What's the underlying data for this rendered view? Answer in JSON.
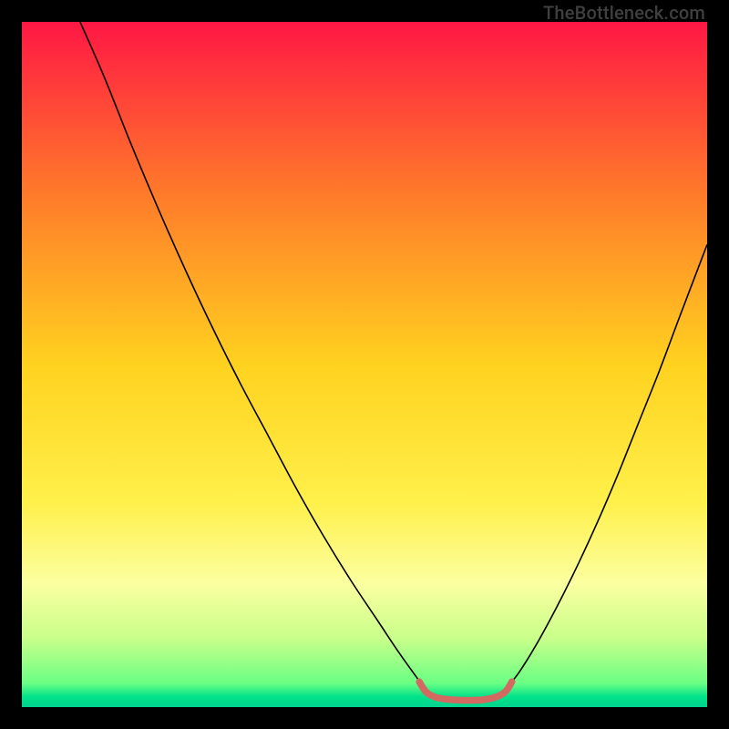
{
  "watermark": "TheBottleneck.com",
  "chart_data": {
    "type": "line",
    "title": "",
    "xlabel": "",
    "ylabel": "",
    "xlim": [
      0,
      100
    ],
    "ylim": [
      0,
      100
    ],
    "background_gradient": {
      "stops": [
        {
          "offset": 0.0,
          "color": "#ff1744"
        },
        {
          "offset": 0.25,
          "color": "#ff7a2a"
        },
        {
          "offset": 0.5,
          "color": "#ffd21f"
        },
        {
          "offset": 0.7,
          "color": "#fff04a"
        },
        {
          "offset": 0.82,
          "color": "#fbffa0"
        },
        {
          "offset": 0.9,
          "color": "#c8ff8a"
        },
        {
          "offset": 0.965,
          "color": "#6bff84"
        },
        {
          "offset": 0.985,
          "color": "#00e28a"
        },
        {
          "offset": 1.0,
          "color": "#00d38f"
        }
      ]
    },
    "series": [
      {
        "name": "left-curve",
        "stroke": "#000000",
        "width": 1.6,
        "points": [
          {
            "x": 8.5,
            "y": 100.0
          },
          {
            "x": 12.0,
            "y": 92.0
          },
          {
            "x": 16.0,
            "y": 82.0
          },
          {
            "x": 20.0,
            "y": 72.5
          },
          {
            "x": 24.0,
            "y": 63.5
          },
          {
            "x": 28.0,
            "y": 55.0
          },
          {
            "x": 32.0,
            "y": 47.0
          },
          {
            "x": 36.0,
            "y": 39.5
          },
          {
            "x": 40.0,
            "y": 32.0
          },
          {
            "x": 44.0,
            "y": 25.0
          },
          {
            "x": 48.0,
            "y": 18.5
          },
          {
            "x": 52.0,
            "y": 12.5
          },
          {
            "x": 55.0,
            "y": 8.0
          },
          {
            "x": 57.5,
            "y": 4.5
          },
          {
            "x": 59.0,
            "y": 2.5
          }
        ]
      },
      {
        "name": "right-curve",
        "stroke": "#000000",
        "width": 1.6,
        "points": [
          {
            "x": 70.5,
            "y": 2.5
          },
          {
            "x": 72.5,
            "y": 5.0
          },
          {
            "x": 75.0,
            "y": 9.0
          },
          {
            "x": 78.0,
            "y": 14.5
          },
          {
            "x": 81.0,
            "y": 20.5
          },
          {
            "x": 84.0,
            "y": 27.0
          },
          {
            "x": 87.0,
            "y": 34.0
          },
          {
            "x": 90.0,
            "y": 41.5
          },
          {
            "x": 93.0,
            "y": 49.0
          },
          {
            "x": 96.0,
            "y": 57.0
          },
          {
            "x": 100.0,
            "y": 67.5
          }
        ]
      },
      {
        "name": "valley-highlight",
        "stroke": "#d26a62",
        "width": 7.5,
        "linecap": "round",
        "points": [
          {
            "x": 58.0,
            "y": 3.7
          },
          {
            "x": 59.0,
            "y": 2.2
          },
          {
            "x": 60.5,
            "y": 1.4
          },
          {
            "x": 62.5,
            "y": 1.1
          },
          {
            "x": 65.0,
            "y": 1.0
          },
          {
            "x": 67.5,
            "y": 1.1
          },
          {
            "x": 69.5,
            "y": 1.6
          },
          {
            "x": 70.7,
            "y": 2.4
          },
          {
            "x": 71.5,
            "y": 3.7
          }
        ]
      }
    ]
  }
}
